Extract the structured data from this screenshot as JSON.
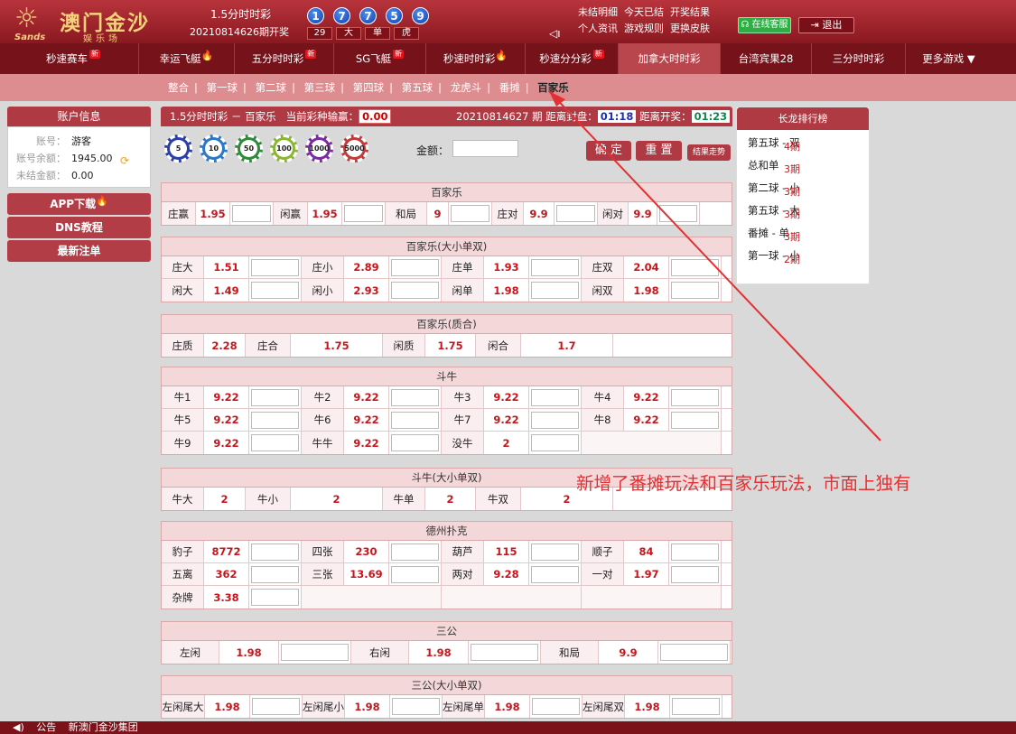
{
  "header": {
    "logo_name": "澳门金沙",
    "logo_sub": "娱乐场",
    "logo_brand": "Sands",
    "lottery_name": "1.5分时时彩",
    "issue_info": "20210814626期开奖",
    "balls": [
      "1",
      "7",
      "7",
      "5",
      "9"
    ],
    "stats": [
      "29",
      "大",
      "单",
      "虎"
    ],
    "links_row1": [
      "未结明细",
      "今天已结",
      "开奖结果"
    ],
    "links_row2": [
      "个人资讯",
      "游戏规则",
      "更换皮肤"
    ],
    "service_label": "在线客服",
    "logout_label": "退出",
    "colors": {
      "header_red": "#b8343c",
      "nav_dark": "#75121a",
      "accent_red": "#b03a43"
    }
  },
  "gamenav": [
    {
      "label": "秒速赛车",
      "badge": "新"
    },
    {
      "label": "幸运飞艇",
      "badge": "hot"
    },
    {
      "label": "五分时时彩",
      "badge": "新"
    },
    {
      "label": "SG飞艇",
      "badge": "新"
    },
    {
      "label": "秒速时时彩",
      "badge": "hot"
    },
    {
      "label": "秒速分分彩",
      "badge": "新"
    },
    {
      "label": "加拿大时时彩",
      "badge": "",
      "active": true
    },
    {
      "label": "台湾宾果28",
      "badge": ""
    },
    {
      "label": "三分时时彩",
      "badge": ""
    },
    {
      "label": "更多游戏 ▼",
      "badge": ""
    }
  ],
  "subnav": [
    "整合",
    "第一球",
    "第二球",
    "第三球",
    "第四球",
    "第五球",
    "龙虎斗",
    "番摊",
    "百家乐"
  ],
  "sidebar": {
    "title": "账户信息",
    "account_label": "账号：",
    "account_value": "游客",
    "balance_label": "账号余额：",
    "balance_value": "1945.00",
    "unsettled_label": "未结金额：",
    "unsettled_value": "0.00",
    "buttons": [
      "APP下载",
      "DNS教程",
      "最新注单"
    ]
  },
  "infobar": {
    "title": "1.5分时时彩 － 百家乐",
    "winloss_label": "当前彩种输赢：",
    "winloss_value": "0.00",
    "issue_label": "20210814627 期 距离封盘：",
    "close_time": "01:18",
    "draw_label": "距离开奖：",
    "draw_time": "01:23"
  },
  "chips": [
    {
      "value": "5",
      "color": "#2c3fa8"
    },
    {
      "value": "10",
      "color": "#2a78c8"
    },
    {
      "value": "50",
      "color": "#2f8a3a"
    },
    {
      "value": "100",
      "color": "#8ab634"
    },
    {
      "value": "1000",
      "color": "#7a2c9e"
    },
    {
      "value": "5000",
      "color": "#c43a3a"
    }
  ],
  "amount_label": "金额：",
  "confirm_label": "确 定",
  "reset_label": "重 置",
  "trend_label": "结果走势",
  "sections": [
    {
      "title": "百家乐",
      "layout": "five",
      "rows": [
        [
          [
            "庄赢",
            "1.95"
          ],
          [
            "闲赢",
            "1.95"
          ],
          [
            "和局",
            "9"
          ],
          [
            "庄对",
            "9.9"
          ],
          [
            "闲对",
            "9.9"
          ]
        ]
      ]
    },
    {
      "title": "百家乐(大小单双)",
      "rows": [
        [
          [
            "庄大",
            "1.51"
          ],
          [
            "庄小",
            "2.89"
          ],
          [
            "庄单",
            "1.93"
          ],
          [
            "庄双",
            "2.04"
          ]
        ],
        [
          [
            "闲大",
            "1.49"
          ],
          [
            "闲小",
            "2.93"
          ],
          [
            "闲单",
            "1.98"
          ],
          [
            "闲双",
            "1.98"
          ]
        ]
      ]
    },
    {
      "title": "百家乐(质合)",
      "layout": "noinput",
      "rows": [
        [
          [
            "庄质",
            "2.28"
          ],
          [
            "庄合",
            "1.75"
          ],
          [
            "闲质",
            "1.75"
          ],
          [
            "闲合",
            "1.7"
          ]
        ]
      ]
    },
    {
      "title": "斗牛",
      "rows": [
        [
          [
            "牛1",
            "9.22"
          ],
          [
            "牛2",
            "9.22"
          ],
          [
            "牛3",
            "9.22"
          ],
          [
            "牛4",
            "9.22"
          ]
        ],
        [
          [
            "牛5",
            "9.22"
          ],
          [
            "牛6",
            "9.22"
          ],
          [
            "牛7",
            "9.22"
          ],
          [
            "牛8",
            "9.22"
          ]
        ],
        [
          [
            "牛9",
            "9.22"
          ],
          [
            "牛牛",
            "9.22"
          ],
          [
            "没牛",
            "2"
          ]
        ]
      ]
    },
    {
      "title": "斗牛(大小单双)",
      "layout": "noinput",
      "rows": [
        [
          [
            "牛大",
            "2"
          ],
          [
            "牛小",
            "2"
          ],
          [
            "牛单",
            "2"
          ],
          [
            "牛双",
            "2"
          ]
        ]
      ]
    },
    {
      "title": "德州扑克",
      "rows": [
        [
          [
            "豹子",
            "8772"
          ],
          [
            "四张",
            "230"
          ],
          [
            "葫芦",
            "115"
          ],
          [
            "顺子",
            "84"
          ]
        ],
        [
          [
            "五离",
            "362"
          ],
          [
            "三张",
            "13.69"
          ],
          [
            "两对",
            "9.28"
          ],
          [
            "一对",
            "1.97"
          ]
        ],
        [
          [
            "杂牌",
            "3.38"
          ]
        ]
      ]
    },
    {
      "title": "三公",
      "layout": "three",
      "rows": [
        [
          [
            "左闲",
            "1.98"
          ],
          [
            "右闲",
            "1.98"
          ],
          [
            "和局",
            "9.9"
          ]
        ]
      ]
    },
    {
      "title": "三公(大小单双)",
      "rows": [
        [
          [
            "左闲尾大",
            "1.98"
          ],
          [
            "左闲尾小",
            "1.98"
          ],
          [
            "左闲尾单",
            "1.98"
          ],
          [
            "左闲尾双",
            "1.98"
          ]
        ]
      ]
    }
  ],
  "longdragon": {
    "title": "长龙排行榜",
    "items": [
      {
        "name": "第五球 - 双",
        "periods": "4期"
      },
      {
        "name": "总和单",
        "periods": "3期"
      },
      {
        "name": "第二球 - 小",
        "periods": "3期"
      },
      {
        "name": "第五球 - 大",
        "periods": "3期"
      },
      {
        "name": "番摊 - 单",
        "periods": "3期"
      },
      {
        "name": "第一球 - 小",
        "periods": "2期"
      }
    ]
  },
  "annotation": "新增了番摊玩法和百家乐玩法，市面上独有",
  "footer": {
    "notice_label": "公告",
    "notice_text": "新澳门金沙集团"
  }
}
